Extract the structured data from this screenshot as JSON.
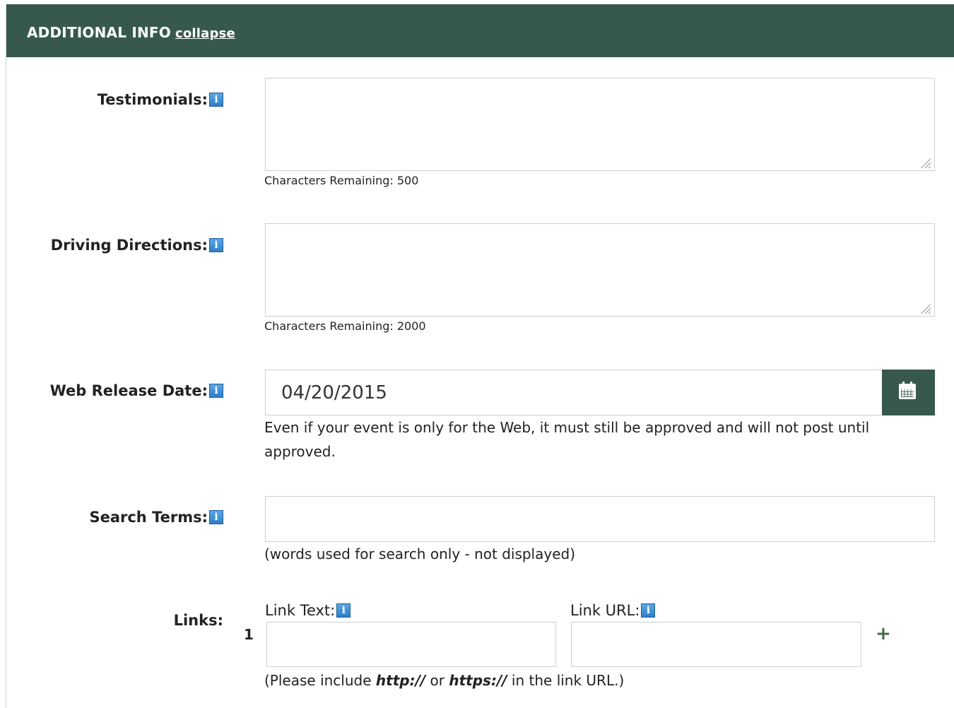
{
  "header": {
    "title": "ADDITIONAL INFO",
    "collapse_link": "collapse"
  },
  "fields": {
    "testimonials": {
      "label": "Testimonials:",
      "value": "",
      "chars_remaining": "Characters Remaining: 500"
    },
    "driving_directions": {
      "label": "Driving Directions:",
      "value": "",
      "chars_remaining": "Characters Remaining: 2000"
    },
    "web_release_date": {
      "label": "Web Release Date:",
      "value": "04/20/2015",
      "note": "Even if your event is only for the Web, it must still be approved and will not post until approved."
    },
    "search_terms": {
      "label": "Search Terms:",
      "value": "",
      "note": "(words used for search only - not displayed)"
    },
    "links": {
      "label": "Links:",
      "row_number": "1",
      "link_text_label": "Link Text:",
      "link_url_label": "Link URL:",
      "link_text_value": "",
      "link_url_value": "",
      "add_label": "+",
      "note_prefix": "(Please include ",
      "note_http": "http://",
      "note_or": " or ",
      "note_https": "https://",
      "note_suffix": " in the link URL.)"
    }
  },
  "colors": {
    "header_bg": "#37594b",
    "info_icon": "#3b8fd6",
    "add_icon": "#3f6b3f"
  },
  "icons": [
    "info-icon",
    "calendar-icon",
    "plus-icon",
    "resize-grip-icon"
  ]
}
